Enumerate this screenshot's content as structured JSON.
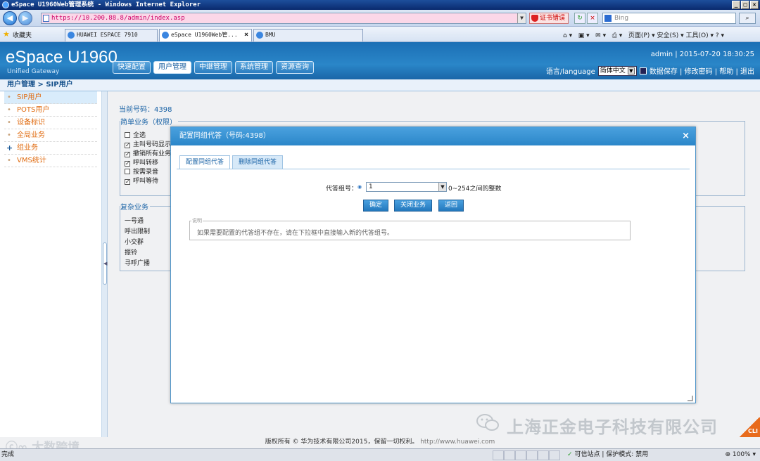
{
  "browser": {
    "title": "eSpace U1960Web管理系统 - Windows Internet Explorer",
    "address": "https://10.200.88.8/admin/index.asp",
    "cert_error": "证书错误",
    "search_placeholder": "Bing",
    "favorites_label": "收藏夹",
    "tabs": [
      {
        "label": "HUAWEI ESPACE 7910"
      },
      {
        "label": "eSpace U1960Web管..."
      },
      {
        "label": "BMU"
      }
    ],
    "commands": "页面(P) ▾  安全(S) ▾  工具(O) ▾",
    "status_left": "完成",
    "status_zone": "可信站点 | 保护模式: 禁用",
    "zoom": "100%"
  },
  "app": {
    "brand": "eSpace U1960",
    "brand_sub": "Unified Gateway",
    "nav": [
      "快速配置",
      "用户管理",
      "中继管理",
      "系统管理",
      "资源查询"
    ],
    "active_nav": 1,
    "user_line": "admin | 2015-07-20 18:30:25",
    "lang_label": "语言/language",
    "lang_value": "简体中文",
    "tool_links": "数据保存 |  修改密码 |  帮助 |  退出"
  },
  "breadcrumb": "用户管理 > SIP用户",
  "sidebar": {
    "items": [
      {
        "label": "SIP用户"
      },
      {
        "label": "POTS用户"
      },
      {
        "label": "设备标识"
      },
      {
        "label": "全局业务"
      },
      {
        "label": "组业务"
      },
      {
        "label": "VMS统计"
      }
    ]
  },
  "main": {
    "current_number": "当前号码：4398",
    "simple_title": "简单业务（权限）",
    "simple_items": [
      {
        "label": "全选",
        "mark": ""
      },
      {
        "label": "主叫号码显示",
        "mark": "✓"
      },
      {
        "label": "撤销所有业务",
        "mark": "✓"
      },
      {
        "label": "呼叫转移",
        "mark": "✓"
      },
      {
        "label": "按需录音",
        "mark": ""
      },
      {
        "label": "呼叫等待",
        "mark": "✓"
      }
    ],
    "complex_title": "复杂业务",
    "complex_items": [
      "一号通",
      "呼出限制",
      "小交群",
      "振铃",
      "寻呼广播"
    ]
  },
  "dialog": {
    "title": "配置同组代答（号码:4398）",
    "close": "×",
    "tabs": [
      "配置同组代答",
      "删除同组代答"
    ],
    "group_label": "代答组号：",
    "group_value": "1",
    "group_hint": "0~254之间的整数",
    "buttons": {
      "ok": "确定",
      "close_service": "关闭业务",
      "back": "返回"
    },
    "note_legend": "说明",
    "note_text": "如果需要配置的代答组不存在，请在下拉框中直接输入新的代答组号。"
  },
  "footer": {
    "copyright": "版权所有 © 华为技术有限公司2015，保留一切权利。",
    "url": "http://www.huawei.com"
  },
  "watermarks": {
    "left": "大数跨境",
    "right": "上海正金电子科技有限公司",
    "corner": "CLI"
  }
}
